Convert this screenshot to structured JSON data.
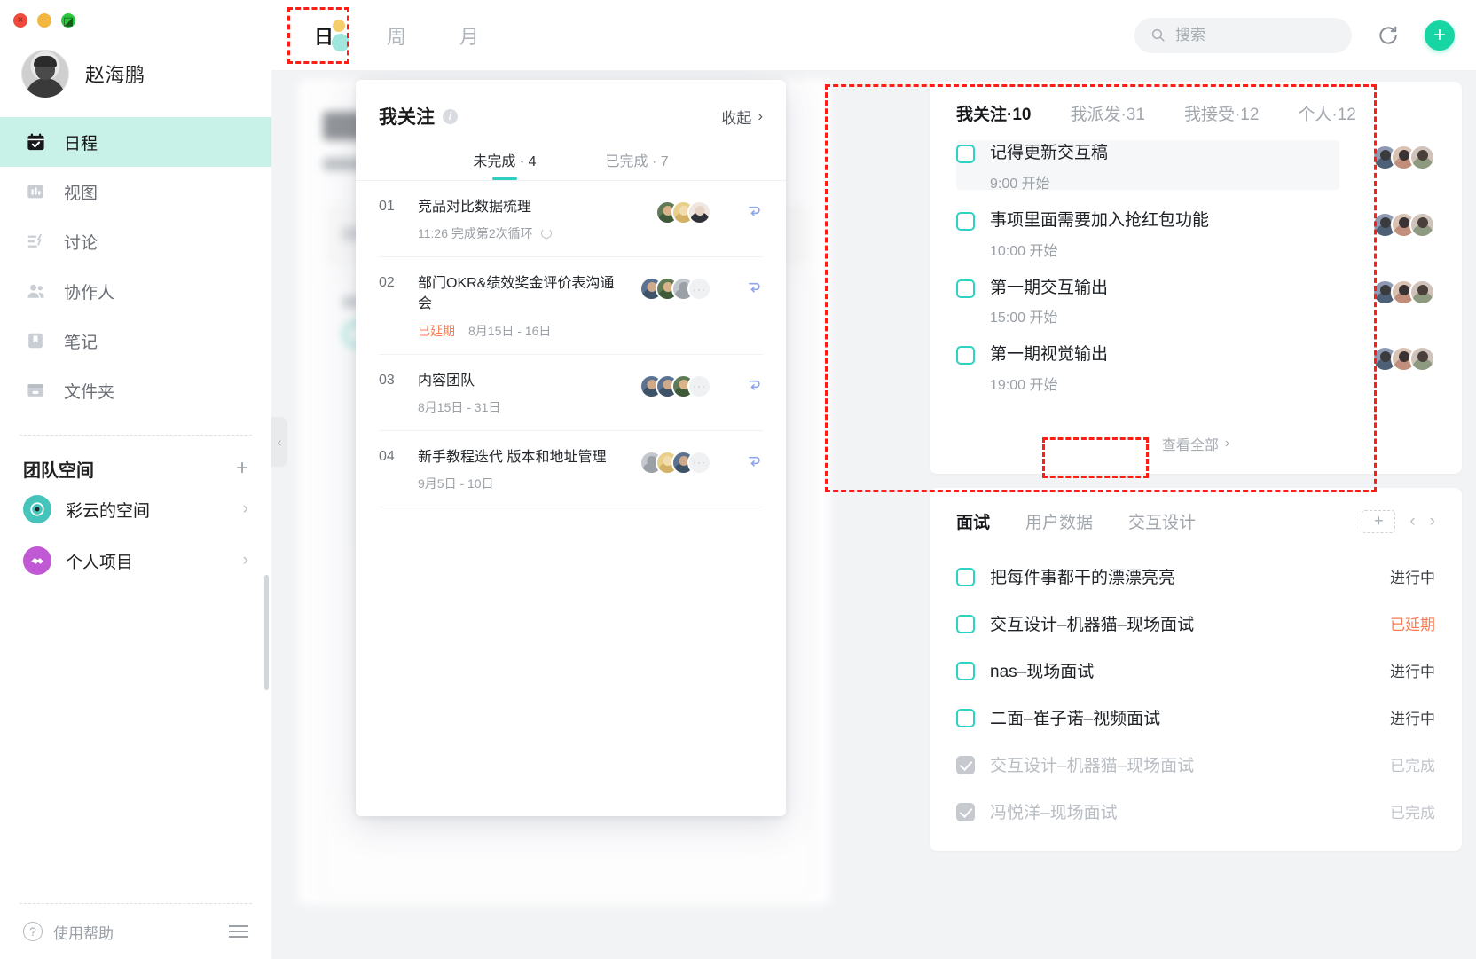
{
  "window": {
    "close": "×",
    "minimize": "−",
    "maximize": "◰"
  },
  "profile": {
    "name": "赵海鹏"
  },
  "sidebar": {
    "nav": [
      {
        "label": "日程",
        "icon": "calendar-check-icon",
        "active": true
      },
      {
        "label": "视图",
        "icon": "chart-bars-icon",
        "active": false
      },
      {
        "label": "讨论",
        "icon": "discussion-icon",
        "active": false
      },
      {
        "label": "协作人",
        "icon": "people-icon",
        "active": false
      },
      {
        "label": "笔记",
        "icon": "bookmark-icon",
        "active": false
      },
      {
        "label": "文件夹",
        "icon": "folder-icon",
        "active": false
      }
    ],
    "team_section": {
      "title": "团队空间",
      "add": "+"
    },
    "spaces": [
      {
        "label": "彩云的空间",
        "icon": "target-icon",
        "color": "#45c4bb",
        "chevron": "›"
      },
      {
        "label": "个人项目",
        "icon": "handshake-icon",
        "color": "#c158d4",
        "chevron": "›"
      }
    ],
    "help": {
      "label": "使用帮助",
      "icon": "question-icon",
      "menu": "hamburger-icon"
    }
  },
  "topbar": {
    "view_tabs": [
      {
        "label": "日",
        "active": true
      },
      {
        "label": "周",
        "active": false
      },
      {
        "label": "月",
        "active": false
      }
    ],
    "search": {
      "placeholder": "搜索",
      "value": ""
    },
    "refresh": "refresh-icon",
    "add": "+"
  },
  "popover": {
    "title": "我关注",
    "info": "i",
    "collapse": "收起",
    "collapse_chevron": "›",
    "tabs": [
      {
        "label": "未完成 · 4",
        "active": true
      },
      {
        "label": "已完成 · 7",
        "active": false
      }
    ],
    "tasks": [
      {
        "index": "01",
        "title": "竞品对比数据梳理",
        "meta": "11:26 完成第2次循环",
        "status": "",
        "has_cycle": true,
        "avatars": [
          "a1",
          "a2",
          "a3"
        ],
        "more": false
      },
      {
        "index": "02",
        "title": "部门OKR&绩效奖金评价表沟通会",
        "status": "已延期",
        "meta": "8月15日 - 16日",
        "has_cycle": false,
        "avatars": [
          "a4",
          "a1",
          "a5"
        ],
        "more": true
      },
      {
        "index": "03",
        "title": "内容团队",
        "status": "",
        "meta": "8月15日 - 31日",
        "has_cycle": false,
        "avatars": [
          "a4",
          "a4",
          "a1"
        ],
        "more": true
      },
      {
        "index": "04",
        "title": "新手教程迭代 版本和地址管理",
        "status": "",
        "meta": "9月5日 - 10日",
        "has_cycle": false,
        "avatars": [
          "a5",
          "a2",
          "a4"
        ],
        "more": true
      }
    ]
  },
  "focus_card": {
    "tabs": [
      {
        "label": "我关注·10",
        "active": true
      },
      {
        "label": "我派发·31",
        "active": false
      },
      {
        "label": "我接受·12",
        "active": false
      },
      {
        "label": "个人·12",
        "active": false
      }
    ],
    "items": [
      {
        "title": "记得更新交互稿",
        "time": "9:00 开始",
        "checked": false,
        "highlighted": true
      },
      {
        "title": "事项里面需要加入抢红包功能",
        "time": "10:00 开始",
        "checked": false,
        "highlighted": false
      },
      {
        "title": "第一期交互输出",
        "time": "15:00 开始",
        "checked": false,
        "highlighted": false
      },
      {
        "title": "第一期视觉输出",
        "time": "19:00 开始",
        "checked": false,
        "highlighted": false
      }
    ],
    "view_all": "查看全部",
    "view_all_chevron": "›"
  },
  "project_card": {
    "tabs": [
      {
        "label": "面试",
        "active": true
      },
      {
        "label": "用户数据",
        "active": false
      },
      {
        "label": "交互设计",
        "active": false
      }
    ],
    "add": "+",
    "prev": "‹",
    "next": "›",
    "rows": [
      {
        "title": "把每件事都干的漂漂亮亮",
        "status": "进行中",
        "state": "progress",
        "checked": false
      },
      {
        "title": "交互设计–机器猫–现场面试",
        "status": "已延期",
        "state": "delay",
        "checked": false
      },
      {
        "title": "nas–现场面试",
        "status": "进行中",
        "state": "progress",
        "checked": false
      },
      {
        "title": "二面–崔子诺–视频面试",
        "status": "进行中",
        "state": "progress",
        "checked": false
      },
      {
        "title": "交互设计–机器猫–现场面试",
        "status": "已完成",
        "state": "finished",
        "checked": true
      },
      {
        "title": "冯悦洋–现场面试",
        "status": "已完成",
        "state": "finished",
        "checked": true
      }
    ]
  },
  "colors": {
    "accent": "#2ecfc0",
    "add_button": "#17d6a4",
    "delay": "#fa7b50",
    "highlight_box": "#ff1d16",
    "active_nav_bg": "#c8f2e8"
  }
}
